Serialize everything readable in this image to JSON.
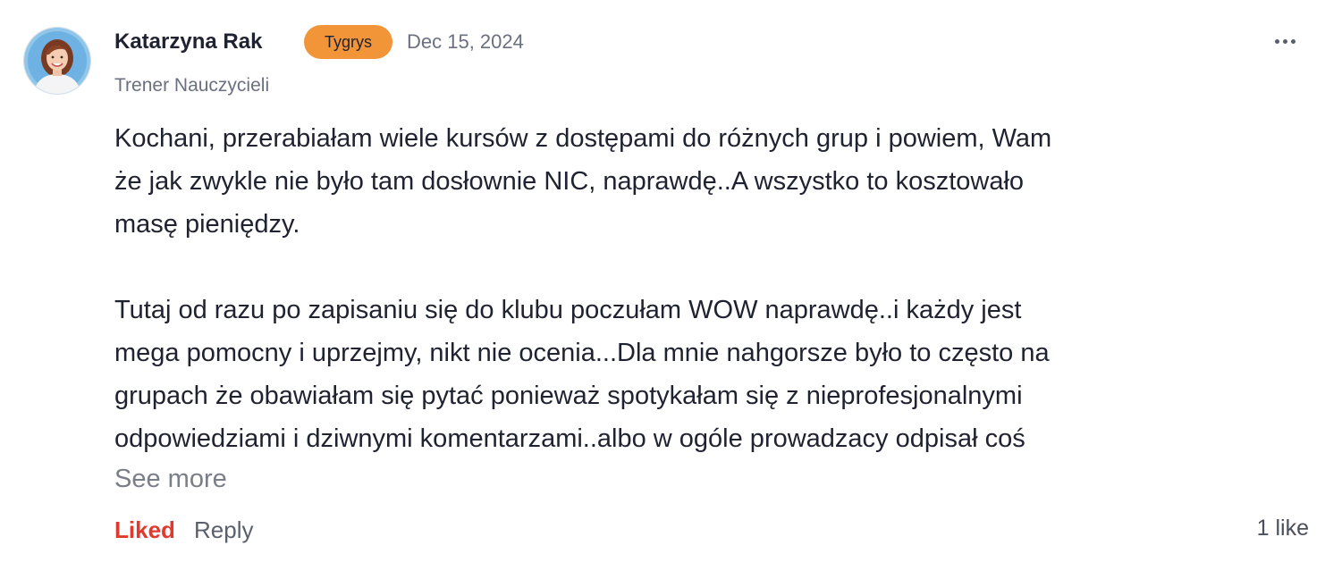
{
  "author": {
    "name": "Katarzyna Rak",
    "badge": "Tygrys",
    "date": "Dec 15, 2024",
    "subtitle": "Trener Nauczycieli"
  },
  "post": {
    "lines_para1": [
      "Kochani, przerabiałam wiele kursów z dostępami do różnych grup i powiem, Wam",
      "że jak zwykle nie było tam dosłownie NIC, naprawdę..A wszystko to kosztowało",
      "masę pieniędzy."
    ],
    "lines_para2": [
      "Tutaj od razu po zapisaniu się do klubu poczułam WOW naprawdę..i każdy jest",
      "mega pomocny i uprzejmy, nikt nie ocenia...Dla mnie nahgorsze było to często na",
      "grupach że obawiałam się pytać ponieważ spotykałam się z nieprofesjonalnymi",
      "odpowiedziami i dziwnymi komentarzami..albo w ogóle prowadzacy odpisał coś"
    ],
    "see_more": "See more"
  },
  "actions": {
    "liked": "Liked",
    "reply": "Reply",
    "likes_count": "1 like"
  },
  "icons": {
    "more": "more-horizontal-icon"
  },
  "colors": {
    "badge_bg": "#f29438",
    "liked": "#e03a2f",
    "muted": "#6b7080",
    "text": "#1f2230"
  }
}
